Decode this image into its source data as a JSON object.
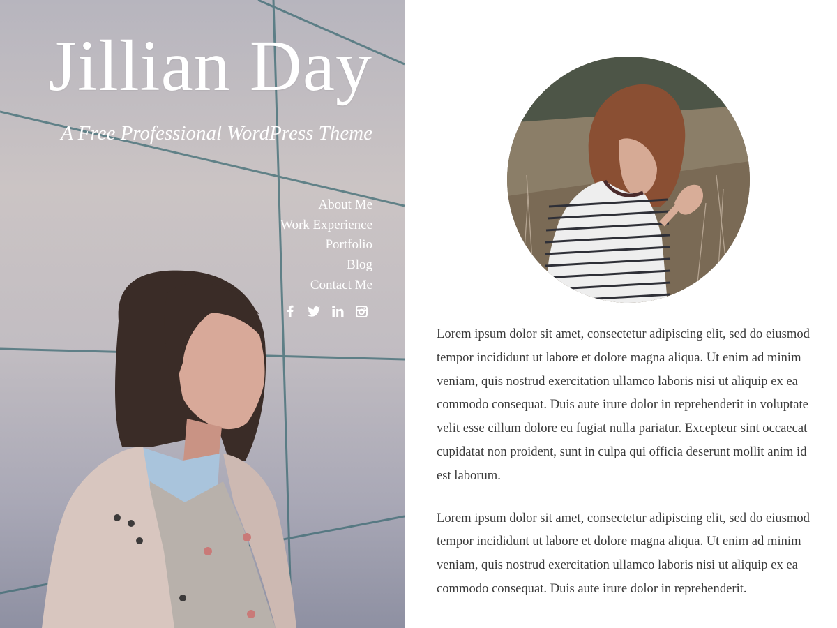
{
  "site": {
    "title": "Jillian Day",
    "tagline": "A Free Professional WordPress Theme"
  },
  "nav": {
    "items": [
      {
        "label": "About Me"
      },
      {
        "label": "Work Experience"
      },
      {
        "label": "Portfolio"
      },
      {
        "label": "Blog"
      },
      {
        "label": "Contact Me"
      }
    ]
  },
  "social": {
    "icons": [
      "facebook-icon",
      "twitter-icon",
      "linkedin-icon",
      "instagram-icon"
    ]
  },
  "content": {
    "paragraphs": [
      "Lorem ipsum dolor sit amet, consectetur adipiscing elit, sed do eiusmod tempor incididunt ut labore et dolore magna aliqua. Ut enim ad minim veniam, quis nostrud exercitation ullamco laboris nisi ut aliquip ex ea commodo consequat. Duis aute irure dolor in reprehenderit in voluptate velit esse cillum dolore eu fugiat nulla pariatur. Excepteur sint occaecat cupidatat non proident, sunt in culpa qui officia deserunt mollit anim id est laborum.",
      "Lorem ipsum dolor sit amet, consectetur adipiscing elit, sed do eiusmod tempor incididunt ut labore et dolore magna aliqua. Ut enim ad minim veniam, quis nostrud exercitation ullamco laboris nisi ut aliquip ex ea commodo consequat. Duis aute irure dolor in reprehenderit."
    ]
  },
  "colors": {
    "text": "#3b3b3b",
    "hero_text": "#ffffff",
    "background": "#ffffff"
  }
}
